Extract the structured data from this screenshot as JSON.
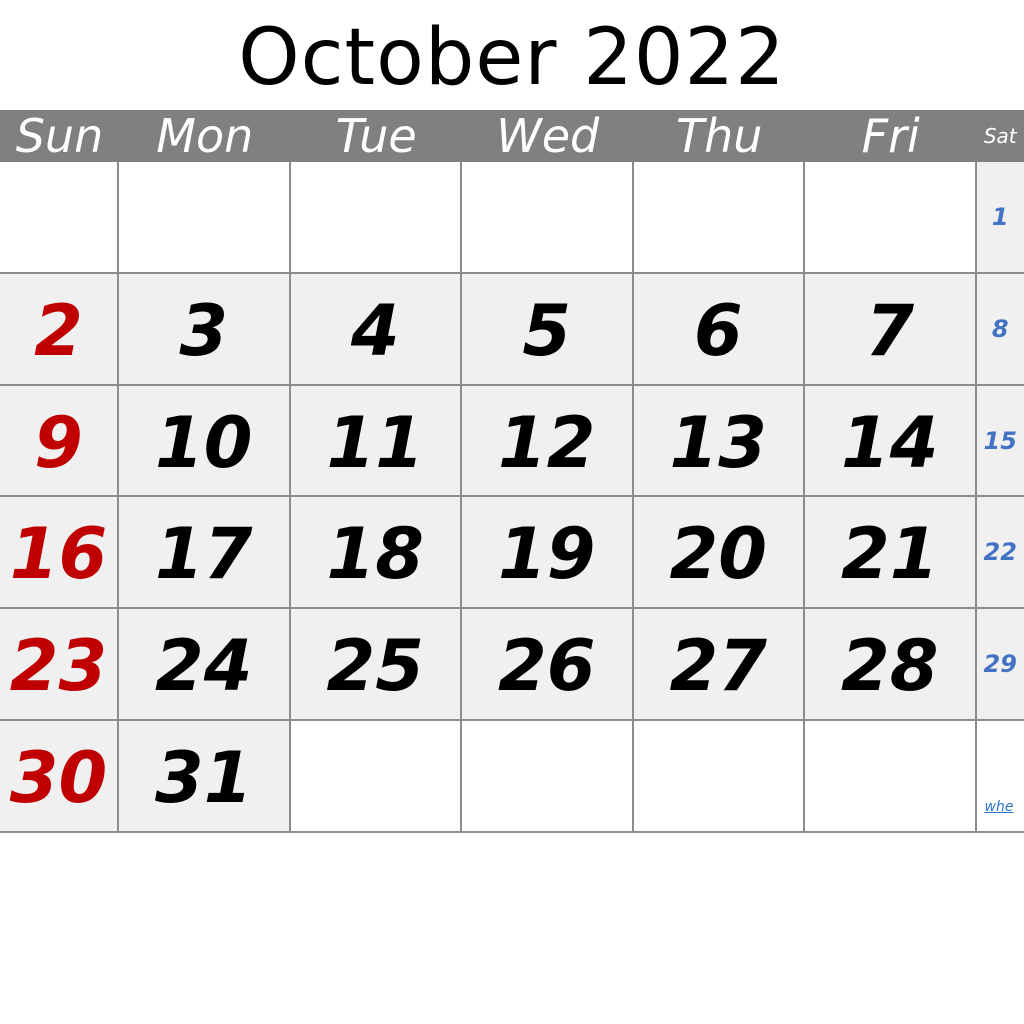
{
  "title": "October 2022",
  "weekdays": [
    "Sun",
    "Mon",
    "Tue",
    "Wed",
    "Thu",
    "Fri",
    "Sat"
  ],
  "weeks": [
    [
      "",
      "",
      "",
      "",
      "",
      "",
      "1"
    ],
    [
      "2",
      "3",
      "4",
      "5",
      "6",
      "7",
      "8"
    ],
    [
      "9",
      "10",
      "11",
      "12",
      "13",
      "14",
      "15"
    ],
    [
      "16",
      "17",
      "18",
      "19",
      "20",
      "21",
      "22"
    ],
    [
      "23",
      "24",
      "25",
      "26",
      "27",
      "28",
      "29"
    ],
    [
      "30",
      "31",
      "",
      "",
      "",
      "",
      ""
    ]
  ],
  "footer_link": "whe",
  "colors": {
    "header_bg": "#808080",
    "filled_cell": "#f0f0f0",
    "sunday": "#c00000",
    "saturday": "#4472c4",
    "grid": "#8c8c8c"
  }
}
